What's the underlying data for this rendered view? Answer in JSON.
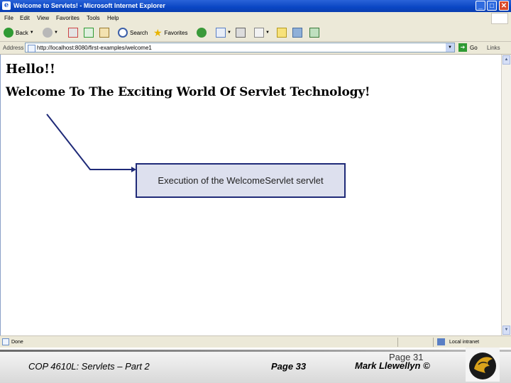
{
  "window": {
    "title": "Welcome to Servlets! - Microsoft Internet Explorer",
    "min_glyph": "_",
    "max_glyph": "□",
    "close_glyph": "✕"
  },
  "menubar": {
    "items": [
      "File",
      "Edit",
      "View",
      "Favorites",
      "Tools",
      "Help"
    ]
  },
  "toolbar": {
    "back_label": "Back",
    "search_label": "Search",
    "favorites_label": "Favorites"
  },
  "address": {
    "label": "Address",
    "url": "http://localhost:8080/first-examples/welcome1",
    "go_label": "Go",
    "links_label": "Links"
  },
  "content": {
    "heading1": "Hello!!",
    "heading2": "Welcome To The Exciting World Of Servlet Technology!",
    "callout": "Execution of the WelcomeServlet servlet"
  },
  "statusbar": {
    "status": "Done",
    "zone": "Local intranet"
  },
  "footer": {
    "course": "COP 4610L: Servlets – Part 2",
    "page": "Page 33",
    "page_overlay": "Page 31",
    "author": "Mark Llewellyn ©"
  },
  "colors": {
    "titlebar": "#0a46c4",
    "callout_border": "#1f2a78",
    "callout_fill": "#dde0ee"
  }
}
